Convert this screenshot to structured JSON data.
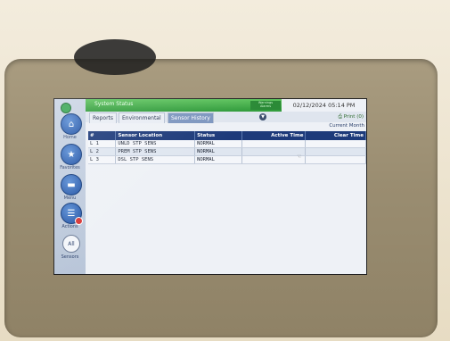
{
  "header": {
    "title": "System Status",
    "alarm_line1": "Warnings",
    "alarm_line2": "Alarms",
    "datetime": "02/12/2024 05:14 PM"
  },
  "rail": {
    "home": "Home",
    "favorites": "Favorites",
    "menu": "Menu",
    "actions": "Actions",
    "all_btn": "All",
    "sensors": "Sensors"
  },
  "tabs": [
    {
      "label": "Reports"
    },
    {
      "label": "Environmental"
    },
    {
      "label": "Sensor History"
    }
  ],
  "print_label": "Print (0)",
  "period": "Current Month",
  "table": {
    "headers": [
      "#",
      "Sensor Location",
      "Status",
      "Active Time",
      "Clear Time"
    ],
    "rows": [
      [
        "L 1",
        "UNLD STP SENS",
        "NORMAL",
        "",
        ""
      ],
      [
        "L 2",
        "PREM STP SENS",
        "NORMAL",
        "",
        ""
      ],
      [
        "L 3",
        "DSL STP SENS",
        "NORMAL",
        "",
        ""
      ]
    ]
  },
  "colors": {
    "header_green": "#2f9a3a",
    "table_header": "#1d3a7a",
    "active_tab": "#7d96bf"
  }
}
